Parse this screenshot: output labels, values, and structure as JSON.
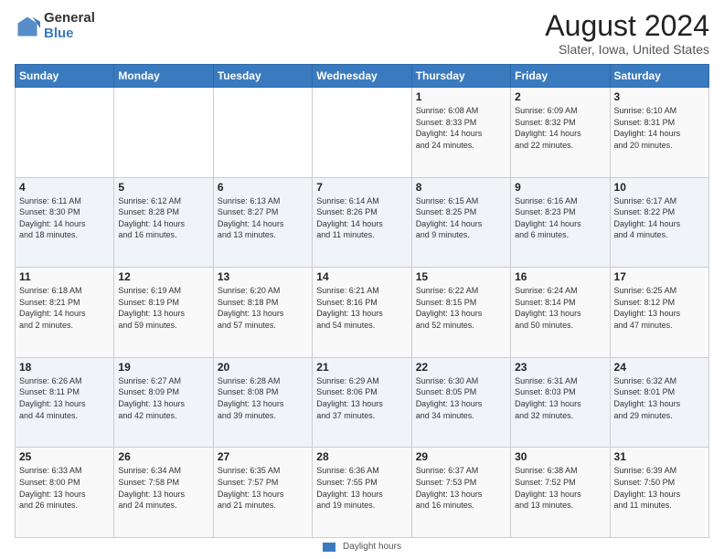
{
  "header": {
    "logo_general": "General",
    "logo_blue": "Blue",
    "month_title": "August 2024",
    "location": "Slater, Iowa, United States"
  },
  "calendar": {
    "days_of_week": [
      "Sunday",
      "Monday",
      "Tuesday",
      "Wednesday",
      "Thursday",
      "Friday",
      "Saturday"
    ],
    "weeks": [
      [
        {
          "day": "",
          "info": ""
        },
        {
          "day": "",
          "info": ""
        },
        {
          "day": "",
          "info": ""
        },
        {
          "day": "",
          "info": ""
        },
        {
          "day": "1",
          "info": "Sunrise: 6:08 AM\nSunset: 8:33 PM\nDaylight: 14 hours\nand 24 minutes."
        },
        {
          "day": "2",
          "info": "Sunrise: 6:09 AM\nSunset: 8:32 PM\nDaylight: 14 hours\nand 22 minutes."
        },
        {
          "day": "3",
          "info": "Sunrise: 6:10 AM\nSunset: 8:31 PM\nDaylight: 14 hours\nand 20 minutes."
        }
      ],
      [
        {
          "day": "4",
          "info": "Sunrise: 6:11 AM\nSunset: 8:30 PM\nDaylight: 14 hours\nand 18 minutes."
        },
        {
          "day": "5",
          "info": "Sunrise: 6:12 AM\nSunset: 8:28 PM\nDaylight: 14 hours\nand 16 minutes."
        },
        {
          "day": "6",
          "info": "Sunrise: 6:13 AM\nSunset: 8:27 PM\nDaylight: 14 hours\nand 13 minutes."
        },
        {
          "day": "7",
          "info": "Sunrise: 6:14 AM\nSunset: 8:26 PM\nDaylight: 14 hours\nand 11 minutes."
        },
        {
          "day": "8",
          "info": "Sunrise: 6:15 AM\nSunset: 8:25 PM\nDaylight: 14 hours\nand 9 minutes."
        },
        {
          "day": "9",
          "info": "Sunrise: 6:16 AM\nSunset: 8:23 PM\nDaylight: 14 hours\nand 6 minutes."
        },
        {
          "day": "10",
          "info": "Sunrise: 6:17 AM\nSunset: 8:22 PM\nDaylight: 14 hours\nand 4 minutes."
        }
      ],
      [
        {
          "day": "11",
          "info": "Sunrise: 6:18 AM\nSunset: 8:21 PM\nDaylight: 14 hours\nand 2 minutes."
        },
        {
          "day": "12",
          "info": "Sunrise: 6:19 AM\nSunset: 8:19 PM\nDaylight: 13 hours\nand 59 minutes."
        },
        {
          "day": "13",
          "info": "Sunrise: 6:20 AM\nSunset: 8:18 PM\nDaylight: 13 hours\nand 57 minutes."
        },
        {
          "day": "14",
          "info": "Sunrise: 6:21 AM\nSunset: 8:16 PM\nDaylight: 13 hours\nand 54 minutes."
        },
        {
          "day": "15",
          "info": "Sunrise: 6:22 AM\nSunset: 8:15 PM\nDaylight: 13 hours\nand 52 minutes."
        },
        {
          "day": "16",
          "info": "Sunrise: 6:24 AM\nSunset: 8:14 PM\nDaylight: 13 hours\nand 50 minutes."
        },
        {
          "day": "17",
          "info": "Sunrise: 6:25 AM\nSunset: 8:12 PM\nDaylight: 13 hours\nand 47 minutes."
        }
      ],
      [
        {
          "day": "18",
          "info": "Sunrise: 6:26 AM\nSunset: 8:11 PM\nDaylight: 13 hours\nand 44 minutes."
        },
        {
          "day": "19",
          "info": "Sunrise: 6:27 AM\nSunset: 8:09 PM\nDaylight: 13 hours\nand 42 minutes."
        },
        {
          "day": "20",
          "info": "Sunrise: 6:28 AM\nSunset: 8:08 PM\nDaylight: 13 hours\nand 39 minutes."
        },
        {
          "day": "21",
          "info": "Sunrise: 6:29 AM\nSunset: 8:06 PM\nDaylight: 13 hours\nand 37 minutes."
        },
        {
          "day": "22",
          "info": "Sunrise: 6:30 AM\nSunset: 8:05 PM\nDaylight: 13 hours\nand 34 minutes."
        },
        {
          "day": "23",
          "info": "Sunrise: 6:31 AM\nSunset: 8:03 PM\nDaylight: 13 hours\nand 32 minutes."
        },
        {
          "day": "24",
          "info": "Sunrise: 6:32 AM\nSunset: 8:01 PM\nDaylight: 13 hours\nand 29 minutes."
        }
      ],
      [
        {
          "day": "25",
          "info": "Sunrise: 6:33 AM\nSunset: 8:00 PM\nDaylight: 13 hours\nand 26 minutes."
        },
        {
          "day": "26",
          "info": "Sunrise: 6:34 AM\nSunset: 7:58 PM\nDaylight: 13 hours\nand 24 minutes."
        },
        {
          "day": "27",
          "info": "Sunrise: 6:35 AM\nSunset: 7:57 PM\nDaylight: 13 hours\nand 21 minutes."
        },
        {
          "day": "28",
          "info": "Sunrise: 6:36 AM\nSunset: 7:55 PM\nDaylight: 13 hours\nand 19 minutes."
        },
        {
          "day": "29",
          "info": "Sunrise: 6:37 AM\nSunset: 7:53 PM\nDaylight: 13 hours\nand 16 minutes."
        },
        {
          "day": "30",
          "info": "Sunrise: 6:38 AM\nSunset: 7:52 PM\nDaylight: 13 hours\nand 13 minutes."
        },
        {
          "day": "31",
          "info": "Sunrise: 6:39 AM\nSunset: 7:50 PM\nDaylight: 13 hours\nand 11 minutes."
        }
      ]
    ]
  },
  "footer": {
    "legend_label": "Daylight hours"
  }
}
